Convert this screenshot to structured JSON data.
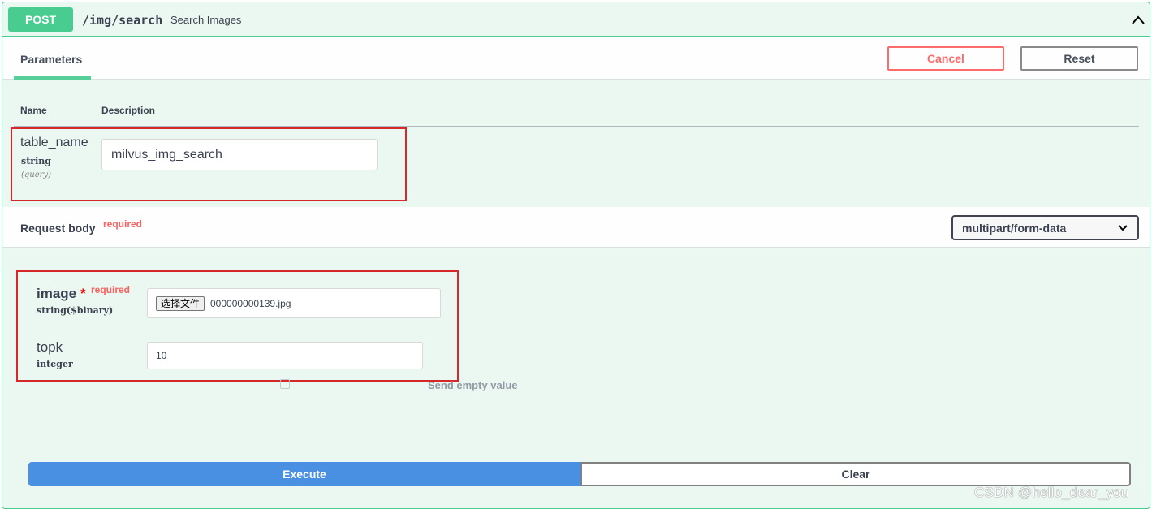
{
  "summary": {
    "method": "POST",
    "path": "/img/search",
    "description": "Search Images"
  },
  "parameters": {
    "tab_label": "Parameters",
    "cancel_label": "Cancel",
    "reset_label": "Reset",
    "col_name": "Name",
    "col_description": "Description",
    "items": [
      {
        "name": "table_name",
        "type": "string",
        "in": "(query)",
        "value": "milvus_img_search"
      }
    ]
  },
  "request_body": {
    "title": "Request body",
    "required_label": "required",
    "content_type": "multipart/form-data",
    "fields": {
      "image": {
        "name": "image",
        "star": "*",
        "required_label": "required",
        "type": "string($binary)",
        "file_button": "选择文件",
        "file_name": "000000000139.jpg"
      },
      "topk": {
        "name": "topk",
        "type": "integer",
        "value": "10"
      }
    },
    "send_empty_label": "Send empty value"
  },
  "actions": {
    "execute_label": "Execute",
    "clear_label": "Clear"
  },
  "watermark": "CSDN @hello_dear_you",
  "colors": {
    "post_green": "#49cc90",
    "cancel_red": "#ff6060",
    "execute_blue": "#4990e2",
    "highlight_red": "#d62828"
  }
}
